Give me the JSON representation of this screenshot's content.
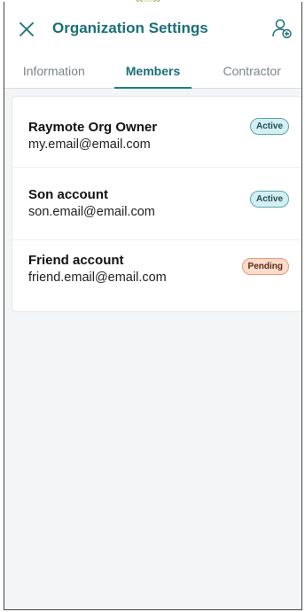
{
  "header": {
    "title": "Organization Settings",
    "close_icon": "close-icon",
    "add_user_icon": "add-user-icon"
  },
  "tabs": [
    {
      "label": "Information",
      "active": false
    },
    {
      "label": "Members",
      "active": true
    },
    {
      "label": "Contractor",
      "active": false
    }
  ],
  "members": [
    {
      "name": "Raymote Org Owner",
      "email": "my.email@email.com",
      "status": "Active"
    },
    {
      "name": "Son account",
      "email": "son.email@email.com",
      "status": "Active"
    },
    {
      "name": "Friend account",
      "email": "friend.email@email.com",
      "status": "Pending"
    }
  ],
  "colors": {
    "accent": "#1a6f78",
    "active_badge_bg": "#d4eef2",
    "pending_badge_bg": "#fadccc"
  }
}
